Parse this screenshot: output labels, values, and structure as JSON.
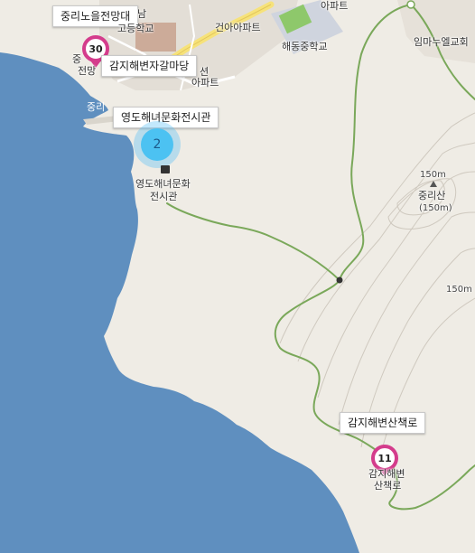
{
  "map": {
    "colors": {
      "sea": "#5f8fbf",
      "land": "#efece5",
      "urban": "#e3ded6",
      "trail": "#7aa85a",
      "pin": "#d43c8c",
      "cluster": "#4cc2f2"
    },
    "callouts": {
      "jungni_observatory": "중리노을전망대",
      "gamji_pebble": "감지해변자갈마당",
      "haenyeo_museum": "영도해녀문화전시관",
      "gamji_trail": "감지해변산책로"
    },
    "markers": {
      "pin_30": "30",
      "cluster_2": "2",
      "pin_11": "11"
    },
    "labels": {
      "nam": "남",
      "high_school": "고등학교",
      "apartment_top": "아파트",
      "geonah_apartment": "건아아파트",
      "haedong_middle": "해동중학교",
      "imanuel_church": "임마누엘교회",
      "seon": "션",
      "apartment_mid": "아파트",
      "jung_partial": "중",
      "jeonmang_partial": "전망",
      "jungni_partial": "중리",
      "museum_line1": "영도해녀문화",
      "museum_line2": "전시관",
      "contour_150_a": "150m",
      "jungni_mountain": "중리산",
      "mountain_height": "(150m)",
      "contour_150_b": "150m",
      "gamji_line1": "감지해변",
      "gamji_line2": "산책로"
    }
  }
}
